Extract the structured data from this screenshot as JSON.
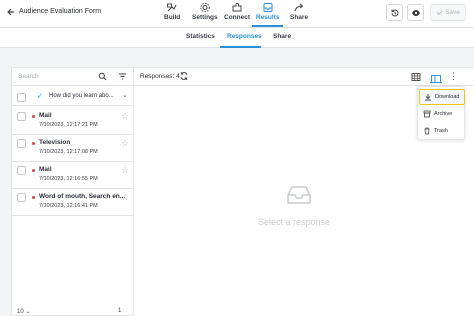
{
  "header": {
    "title": "Audience Evaluation Form",
    "nav": [
      {
        "label": "Build",
        "icon": "build-icon",
        "active": false
      },
      {
        "label": "Settings",
        "icon": "gear-icon",
        "active": false
      },
      {
        "label": "Connect",
        "icon": "puzzle-icon",
        "active": false
      },
      {
        "label": "Results",
        "icon": "inbox-icon",
        "active": true
      },
      {
        "label": "Share",
        "icon": "share-icon",
        "active": false
      }
    ],
    "save_label": "Save"
  },
  "subtabs": [
    {
      "label": "Statistics",
      "active": false
    },
    {
      "label": "Responses",
      "active": true
    },
    {
      "label": "Share",
      "active": false
    }
  ],
  "left_panel": {
    "search_placeholder": "Search",
    "question": "How did you learn abo...",
    "responses": [
      {
        "title": "Mail",
        "date": "7/10/2023, 12:17:21 PM"
      },
      {
        "title": "Television",
        "date": "7/10/2023, 12:17:08 PM"
      },
      {
        "title": "Mail",
        "date": "7/10/2023, 12:16:55 PM"
      },
      {
        "title": "Word of mouth, Search en...",
        "date": "7/10/2023, 12:16:41 PM"
      }
    ],
    "page_size": "10",
    "page_number": "1"
  },
  "main_panel": {
    "responses_label": "Responses: 4",
    "empty_text": "Select a response"
  },
  "menu": {
    "items": [
      {
        "label": "Download",
        "icon": "download-icon"
      },
      {
        "label": "Archive",
        "icon": "archive-icon"
      },
      {
        "label": "Trash",
        "icon": "trash-icon"
      }
    ]
  },
  "colors": {
    "accent": "#2b90d9",
    "highlight": "#f0c419",
    "unread_dot": "#d64545"
  }
}
